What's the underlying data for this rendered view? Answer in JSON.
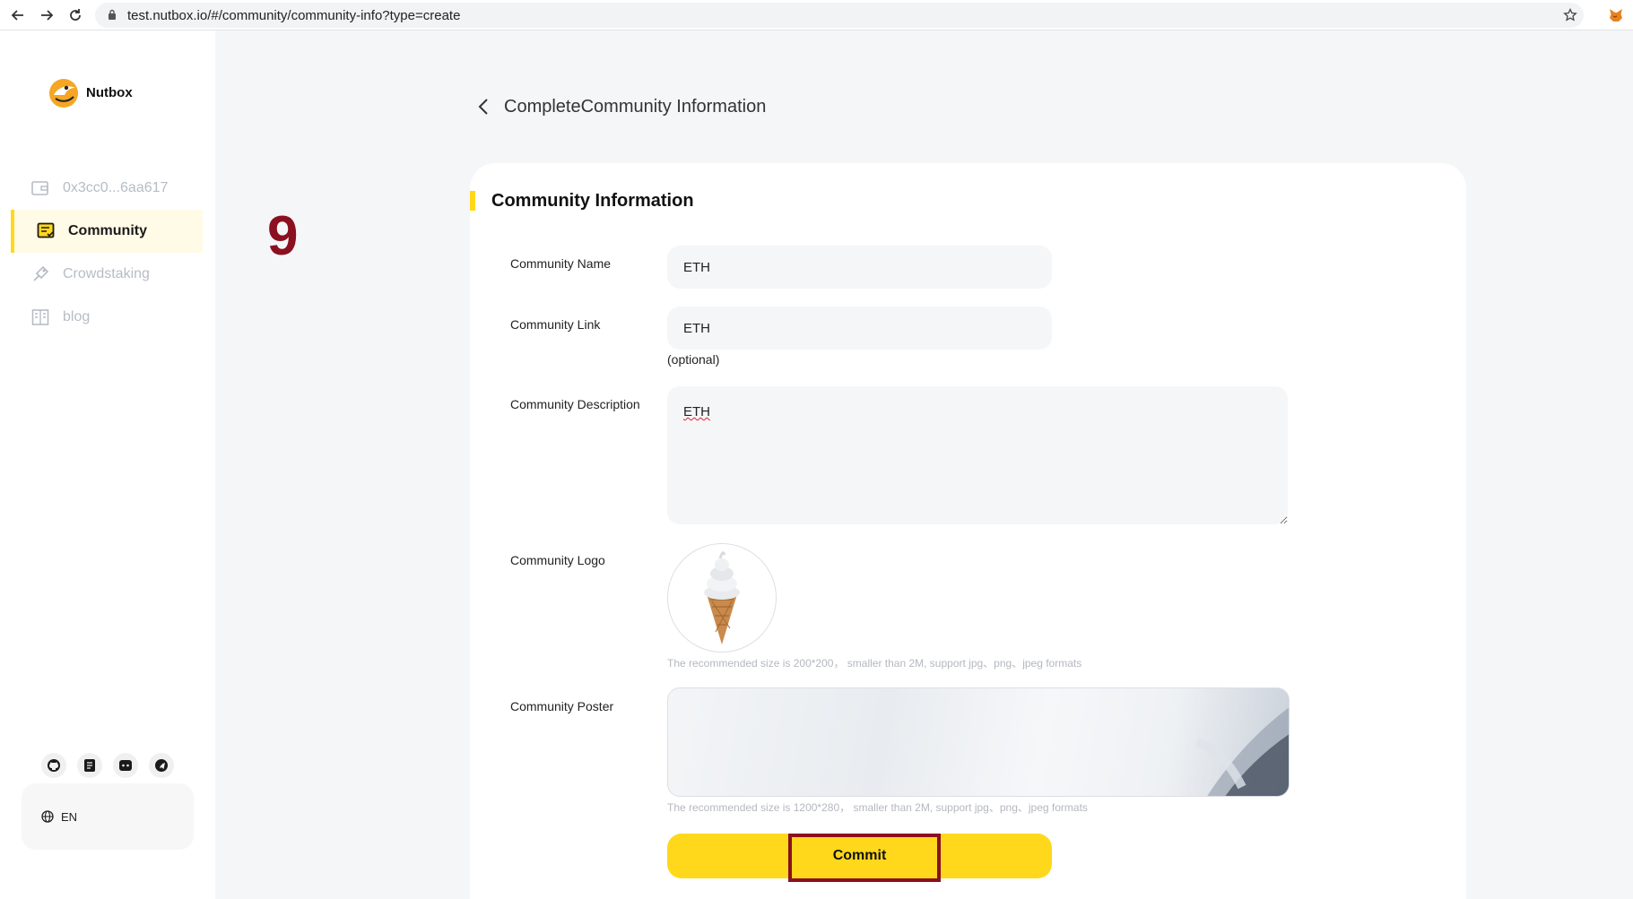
{
  "browser": {
    "url": "test.nutbox.io/#/community/community-info?type=create"
  },
  "sidebar": {
    "brand": "Nutbox",
    "items": [
      {
        "label": "0x3cc0...6aa617",
        "icon": "wallet-icon"
      },
      {
        "label": "Community",
        "icon": "community-icon"
      },
      {
        "label": "Crowdstaking",
        "icon": "crowdstaking-icon"
      },
      {
        "label": "blog",
        "icon": "blog-icon"
      }
    ],
    "socials": [
      "github-icon",
      "docs-icon",
      "discord-icon",
      "telegram-icon"
    ],
    "language": "EN"
  },
  "annotation": {
    "step": "9"
  },
  "header": {
    "title": "CompleteCommunity Information"
  },
  "form": {
    "section_title": "Community Information",
    "name_label": "Community Name",
    "name_value": "ETH",
    "link_label": "Community Link",
    "link_value": "ETH",
    "link_hint": "(optional)",
    "description_label": "Community Description",
    "description_value": "ETH",
    "logo_label": "Community Logo",
    "logo_hint": "The recommended size is 200*200， smaller than 2M, support jpg、png、jpeg formats",
    "poster_label": "Community Poster",
    "poster_hint": "The recommended size is 1200*280， smaller than 2M, support jpg、png、jpeg formats",
    "commit_label": "Commit"
  },
  "colors": {
    "accent": "#ffd81c",
    "annotation": "#8b1020"
  }
}
